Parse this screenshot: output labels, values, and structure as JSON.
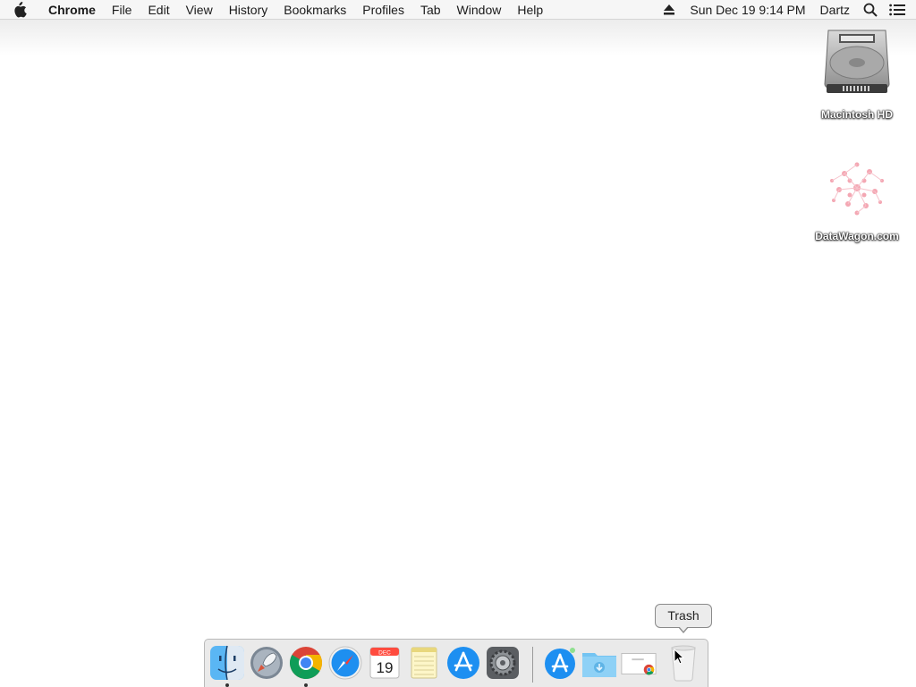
{
  "menubar": {
    "app_name": "Chrome",
    "items": [
      "File",
      "Edit",
      "View",
      "History",
      "Bookmarks",
      "Profiles",
      "Tab",
      "Window",
      "Help"
    ],
    "datetime": "Sun Dec 19  9:14 PM",
    "user": "Dartz"
  },
  "desktop": {
    "icons": [
      {
        "label": "Macintosh HD",
        "icon": "hard-drive-icon"
      },
      {
        "label": "DataWagon.com",
        "icon": "datawagon-icon"
      }
    ]
  },
  "dock": {
    "apps": [
      {
        "name": "Finder",
        "icon": "finder-icon",
        "running": true
      },
      {
        "name": "Launchpad",
        "icon": "launchpad-icon",
        "running": false
      },
      {
        "name": "Google Chrome",
        "icon": "chrome-icon",
        "running": true
      },
      {
        "name": "Safari",
        "icon": "safari-icon",
        "running": false
      },
      {
        "name": "Calendar",
        "icon": "calendar-icon",
        "running": false,
        "month": "DEC",
        "day": "19"
      },
      {
        "name": "Notes",
        "icon": "notes-icon",
        "running": false
      },
      {
        "name": "App Store",
        "icon": "app-store-icon",
        "running": false
      },
      {
        "name": "System Preferences",
        "icon": "system-preferences-icon",
        "running": false
      }
    ],
    "others": [
      {
        "name": "Applications",
        "icon": "applications-stack-icon"
      },
      {
        "name": "Downloads",
        "icon": "downloads-folder-icon"
      },
      {
        "name": "Chrome Document",
        "icon": "chrome-document-icon"
      },
      {
        "name": "Trash",
        "icon": "trash-icon"
      }
    ],
    "tooltip": "Trash"
  },
  "colors": {
    "menubar_bg": "#f6f6f6",
    "desktop_bg": "#ffffff",
    "dock_bg": "#e8e8e8"
  }
}
